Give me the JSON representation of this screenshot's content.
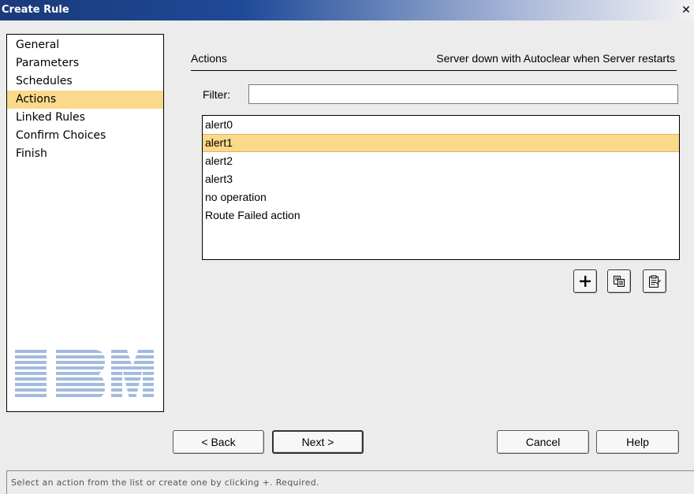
{
  "window": {
    "title": "Create Rule",
    "close_glyph": "✕",
    "close_icon": "close-icon"
  },
  "nav": {
    "items": [
      {
        "label": "General"
      },
      {
        "label": "Parameters"
      },
      {
        "label": "Schedules"
      },
      {
        "label": "Actions",
        "selected": true
      },
      {
        "label": "Linked Rules"
      },
      {
        "label": "Confirm Choices"
      },
      {
        "label": "Finish"
      }
    ],
    "logo": "IBM"
  },
  "main": {
    "section_title": "Actions",
    "section_subtitle": "Server down with Autoclear when Server restarts",
    "filter": {
      "label": "Filter:",
      "value": ""
    },
    "actions": [
      {
        "label": "alert0"
      },
      {
        "label": "alert1",
        "selected": true
      },
      {
        "label": "alert2"
      },
      {
        "label": "alert3"
      },
      {
        "label": "no operation"
      },
      {
        "label": "Route Failed action"
      }
    ],
    "tools": [
      {
        "name": "add-action-button",
        "icon": "plus-icon"
      },
      {
        "name": "copy-action-button",
        "icon": "copy-icon"
      },
      {
        "name": "properties-action-button",
        "icon": "properties-icon"
      }
    ]
  },
  "buttons": {
    "back": "< Back",
    "next": "Next >",
    "cancel": "Cancel",
    "help": "Help"
  },
  "status": {
    "text": "Select an action from the list or create one by clicking +. Required."
  },
  "colors": {
    "selection": "#fbd98a",
    "titlebar_start": "#1a3a7a",
    "background": "#ececec",
    "logo": "#9fb6d8"
  }
}
